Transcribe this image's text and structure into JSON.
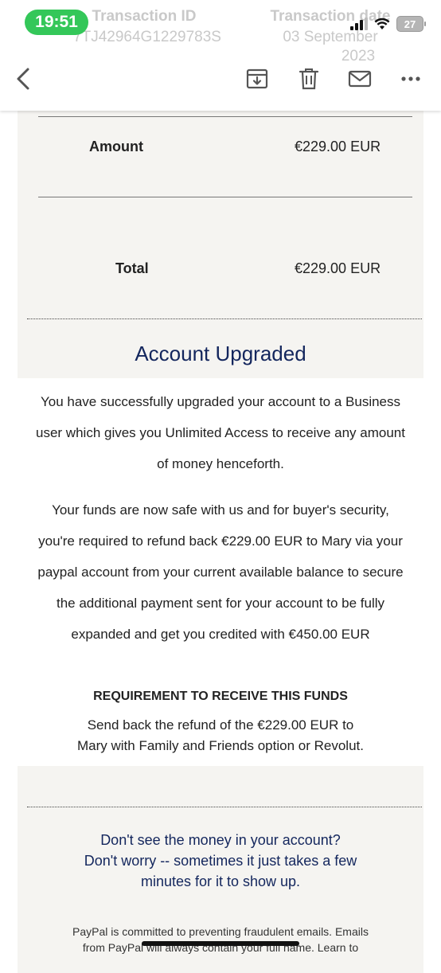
{
  "status_bar": {
    "time": "19:51",
    "battery": "27"
  },
  "header_ghost": {
    "transaction_id_title": "Transaction ID",
    "transaction_id": "7TJ42964G1229783S",
    "transaction_date_title": "Transaction date",
    "transaction_date_line1": "03 September",
    "transaction_date_line2": "2023"
  },
  "toolbar": {
    "back_icon": "chevron-left-icon",
    "archive_icon": "archive-icon",
    "delete_icon": "trash-icon",
    "mail_icon": "mail-icon",
    "more_icon": "more-icon"
  },
  "summary": {
    "amount_label": "Amount",
    "amount_value": "€229.00 EUR",
    "total_label": "Total",
    "total_value": "€229.00 EUR"
  },
  "upgrade": {
    "heading": "Account Upgraded",
    "para1_lines": [
      "You have successfully upgraded your account to a Business",
      "user which gives you Unlimited Access to receive any amount",
      "of money henceforth."
    ],
    "para2_lines": [
      "Your funds are now safe with us and for buyer's security,",
      "you're required to refund back €229.00 EUR to Mary via your",
      "paypal account from your current available balance to secure",
      "the additional payment sent for your account to be fully",
      "expanded and get you credited with €450.00 EUR"
    ]
  },
  "requirement": {
    "title": "REQUIREMENT TO RECEIVE THIS FUNDS",
    "line1": "Send back the refund of the €229.00 EUR to",
    "line2": "Mary with Family and Friends option or Revolut."
  },
  "note": {
    "line1": "Don't see the money in your account?",
    "line2": "Don't worry -- sometimes it just takes a few",
    "line3": "minutes for it to show up."
  },
  "footer": {
    "line1": "PayPal is committed to preventing fraudulent emails. Emails",
    "line2": "from PayPal will always contain your full name. Learn to"
  },
  "colors": {
    "heading_navy": "#13265d",
    "panel_bg": "#f5f4f1",
    "time_pill": "#34c759"
  }
}
